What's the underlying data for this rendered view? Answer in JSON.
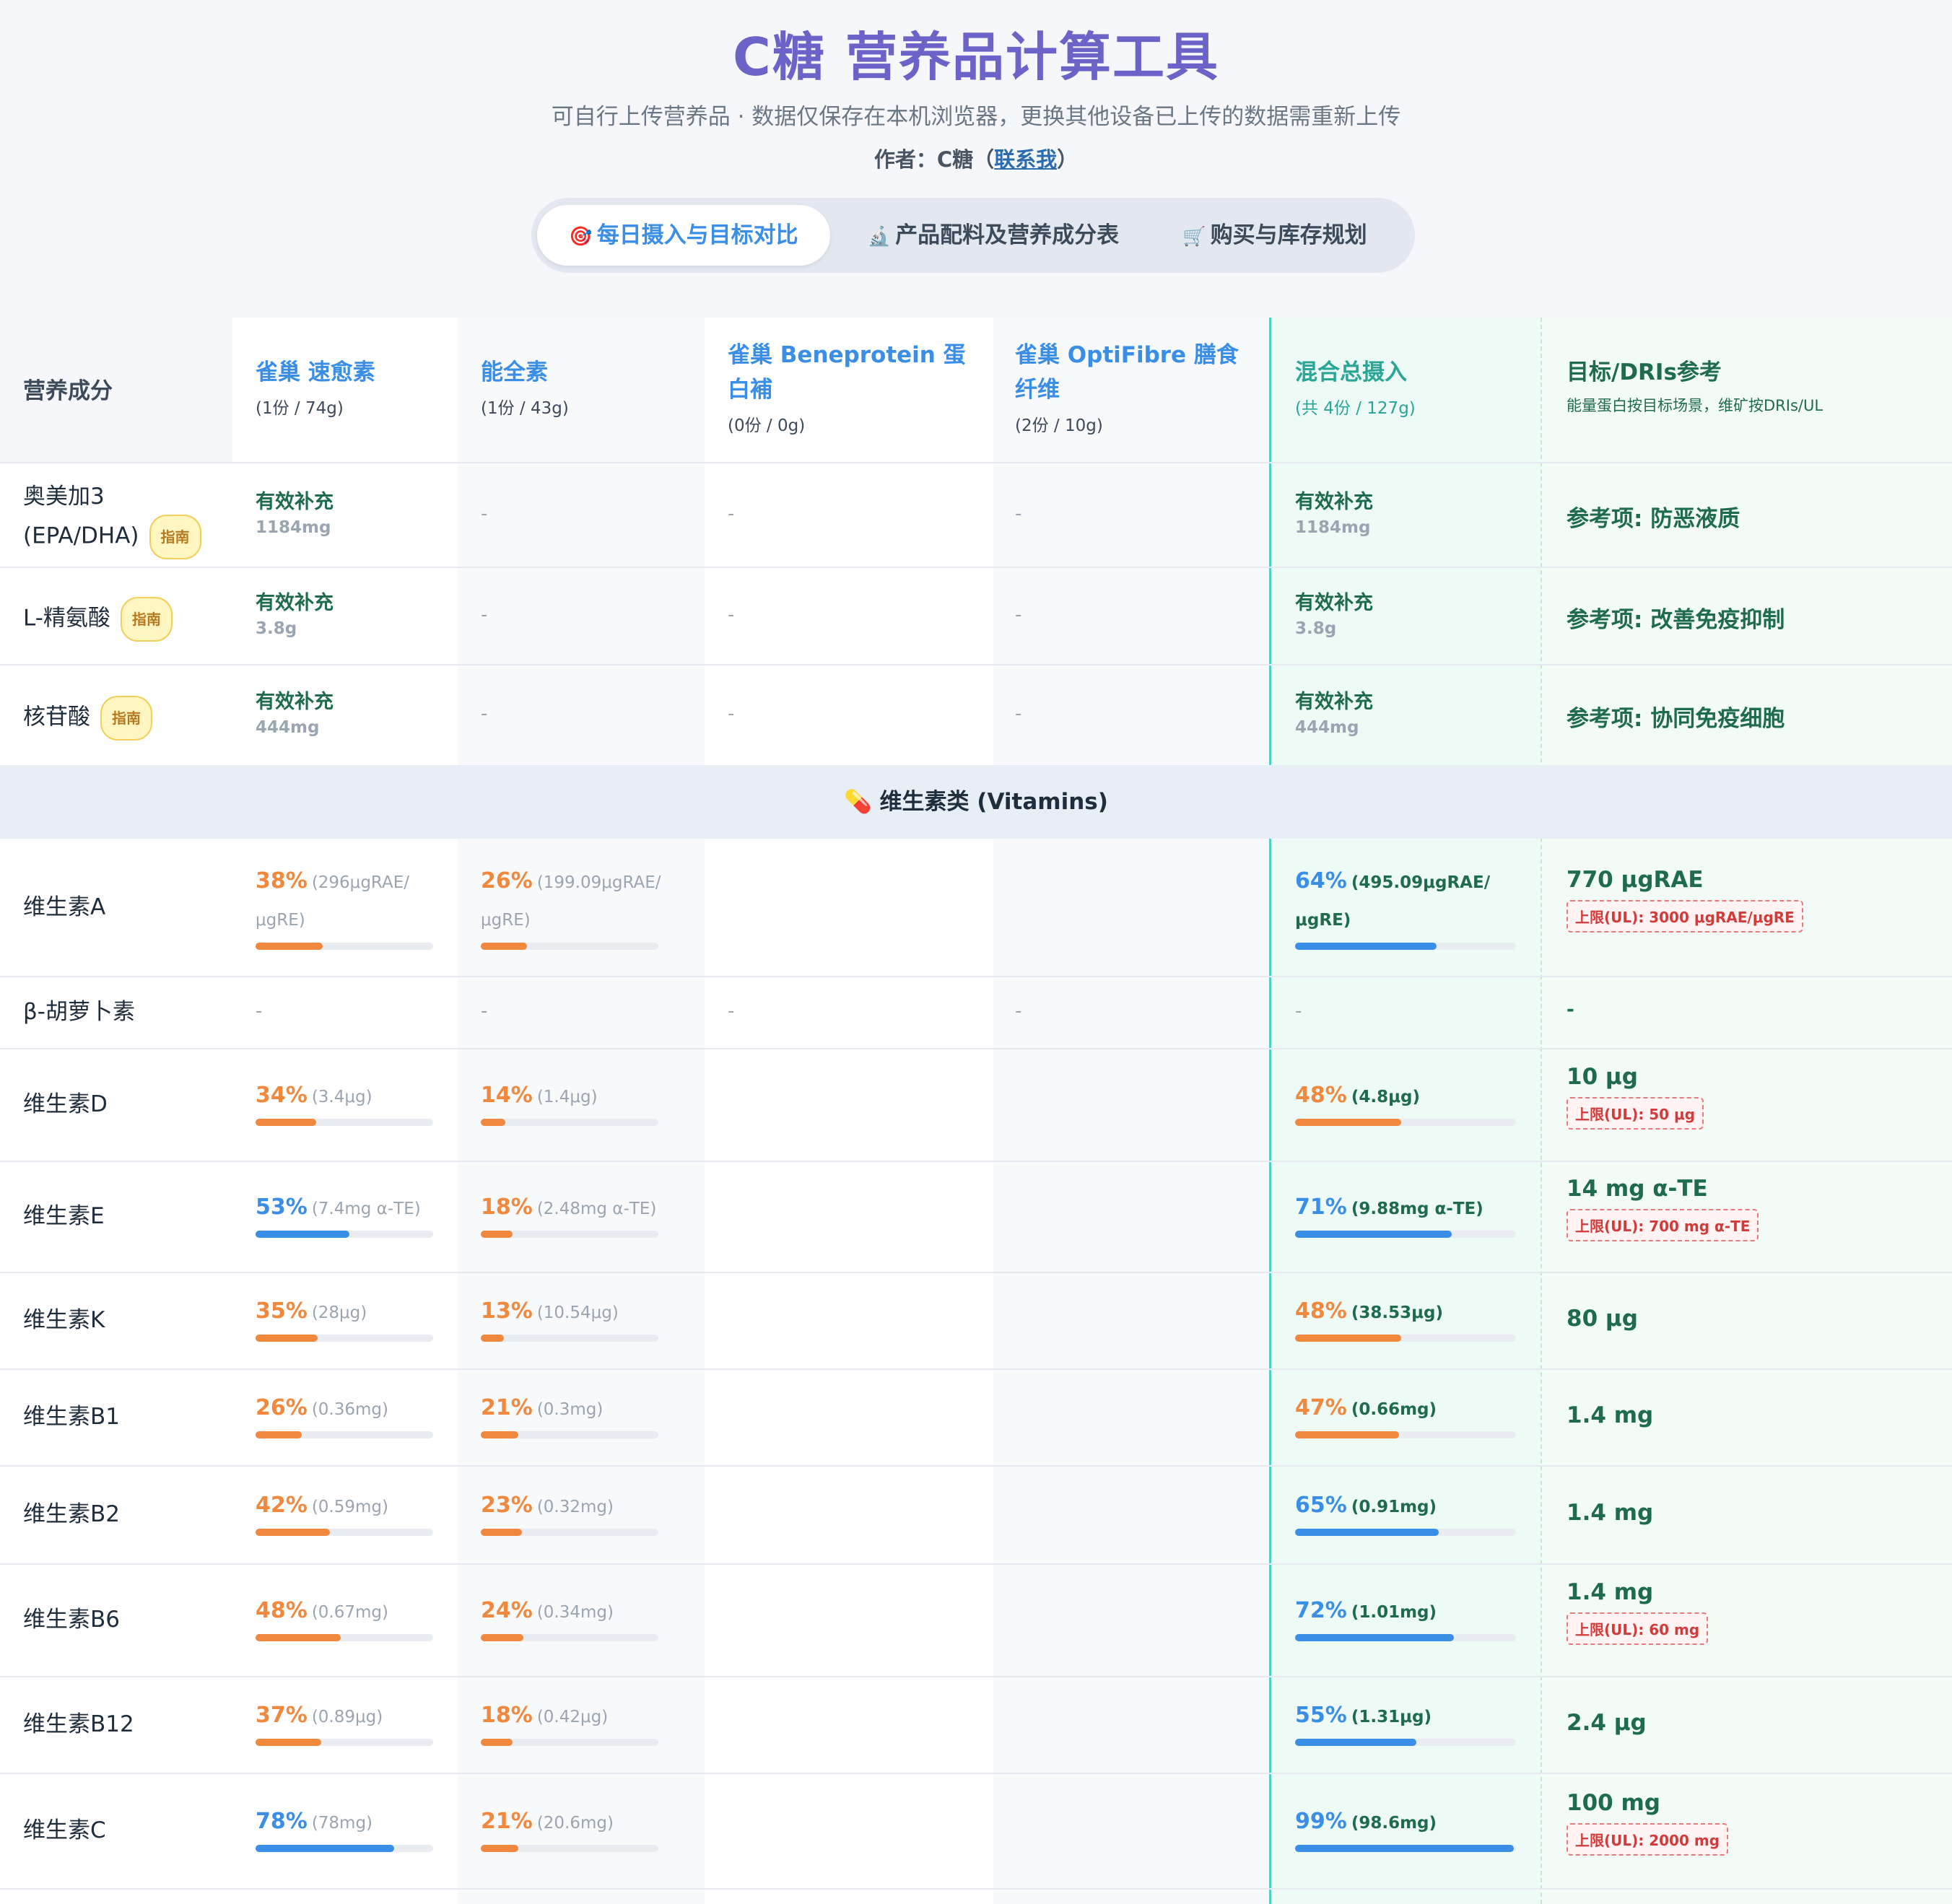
{
  "header": {
    "title": "C糖 营养品计算工具",
    "subtitle": "可自行上传营养品 · 数据仅保存在本机浏览器，更换其他设备已上传的数据需重新上传",
    "author_prefix": "作者：C糖（",
    "author_link": "联系我",
    "author_suffix": "）"
  },
  "tabs": [
    {
      "icon": "🎯",
      "label": "每日摄入与目标对比",
      "active": true
    },
    {
      "icon": "🔬",
      "label": "产品配料及营养成分表",
      "active": false
    },
    {
      "icon": "🛒",
      "label": "购买与库存规划",
      "active": false
    }
  ],
  "table": {
    "first_header": "营养成分",
    "columns": [
      {
        "name": "雀巢 速愈素",
        "sub": "(1份 / 74g)"
      },
      {
        "name": "能全素",
        "sub": "(1份 / 43g)"
      },
      {
        "name": "雀巢 Beneprotein 蛋白補",
        "sub": "(0份 / 0g)"
      },
      {
        "name": "雀巢 OptiFibre 膳食纤维",
        "sub": "(2份 / 10g)"
      },
      {
        "name": "混合总摄入",
        "sub": "(共 4份 / 127g)"
      },
      {
        "name": "目标/DRIs参考",
        "sub": "能量蛋白按目标场景，维矿按DRIs/UL"
      }
    ],
    "guide_label": "指南",
    "dash": "-",
    "special_rows": [
      {
        "name": "奥美加3 (EPA/DHA)",
        "status": "有效补充",
        "amount": "1184mg",
        "total_status": "有效补充",
        "total_amount": "1184mg",
        "ref": "参考项: 防恶液质"
      },
      {
        "name": "L-精氨酸",
        "status": "有效补充",
        "amount": "3.8g",
        "total_status": "有效补充",
        "total_amount": "3.8g",
        "ref": "参考项: 改善免疫抑制"
      },
      {
        "name": "核苷酸",
        "status": "有效补充",
        "amount": "444mg",
        "total_status": "有效补充",
        "total_amount": "444mg",
        "ref": "参考项: 协同免疫细胞"
      }
    ],
    "section_icon": "💊",
    "section_title": "维生素类 (Vitamins)",
    "vitamins": [
      {
        "name": "维生素A",
        "c1": {
          "pct": "38%",
          "val": "(296μgRAE/μgRE)",
          "fill": 38
        },
        "c2": {
          "pct": "26%",
          "val": "(199.09μgRAE/μgRE)",
          "fill": 26
        },
        "total": {
          "pct": "64%",
          "val": "(495.09μgRAE/μgRE)",
          "fill": 64
        },
        "target": "770 μgRAE",
        "ul": "上限(UL): 3000 μgRAE/μgRE"
      },
      {
        "name": "β-胡萝卜素",
        "empty": true,
        "target_dash": "-"
      },
      {
        "name": "维生素D",
        "c1": {
          "pct": "34%",
          "val": "(3.4μg)",
          "fill": 34
        },
        "c2": {
          "pct": "14%",
          "val": "(1.4μg)",
          "fill": 14
        },
        "total": {
          "pct": "48%",
          "val": "(4.8μg)",
          "fill": 48
        },
        "target": "10 μg",
        "ul": "上限(UL): 50 μg"
      },
      {
        "name": "维生素E",
        "c1": {
          "pct": "53%",
          "val": "(7.4mg α-TE)",
          "fill": 53
        },
        "c2": {
          "pct": "18%",
          "val": "(2.48mg α-TE)",
          "fill": 18
        },
        "total": {
          "pct": "71%",
          "val": "(9.88mg α-TE)",
          "fill": 71
        },
        "target": "14 mg α-TE",
        "ul": "上限(UL): 700 mg α-TE"
      },
      {
        "name": "维生素K",
        "c1": {
          "pct": "35%",
          "val": "(28μg)",
          "fill": 35
        },
        "c2": {
          "pct": "13%",
          "val": "(10.54μg)",
          "fill": 13
        },
        "total": {
          "pct": "48%",
          "val": "(38.53μg)",
          "fill": 48
        },
        "target": "80 μg"
      },
      {
        "name": "维生素B1",
        "c1": {
          "pct": "26%",
          "val": "(0.36mg)",
          "fill": 26
        },
        "c2": {
          "pct": "21%",
          "val": "(0.3mg)",
          "fill": 21
        },
        "total": {
          "pct": "47%",
          "val": "(0.66mg)",
          "fill": 47
        },
        "target": "1.4 mg"
      },
      {
        "name": "维生素B2",
        "c1": {
          "pct": "42%",
          "val": "(0.59mg)",
          "fill": 42
        },
        "c2": {
          "pct": "23%",
          "val": "(0.32mg)",
          "fill": 23
        },
        "total": {
          "pct": "65%",
          "val": "(0.91mg)",
          "fill": 65
        },
        "target": "1.4 mg"
      },
      {
        "name": "维生素B6",
        "c1": {
          "pct": "48%",
          "val": "(0.67mg)",
          "fill": 48
        },
        "c2": {
          "pct": "24%",
          "val": "(0.34mg)",
          "fill": 24
        },
        "total": {
          "pct": "72%",
          "val": "(1.01mg)",
          "fill": 72
        },
        "target": "1.4 mg",
        "ul": "上限(UL): 60 mg"
      },
      {
        "name": "维生素B12",
        "c1": {
          "pct": "37%",
          "val": "(0.89μg)",
          "fill": 37
        },
        "c2": {
          "pct": "18%",
          "val": "(0.42μg)",
          "fill": 18
        },
        "total": {
          "pct": "55%",
          "val": "(1.31μg)",
          "fill": 55
        },
        "target": "2.4 μg"
      },
      {
        "name": "维生素C",
        "c1": {
          "pct": "78%",
          "val": "(78mg)",
          "fill": 78
        },
        "c2": {
          "pct": "21%",
          "val": "(20.6mg)",
          "fill": 21
        },
        "total": {
          "pct": "99%",
          "val": "(98.6mg)",
          "fill": 99
        },
        "target": "100 mg",
        "ul": "上限(UL): 2000 mg"
      }
    ]
  },
  "colors": {
    "accent": "#3a8ee6",
    "orange": "#f0883e",
    "green": "#1f6b4d",
    "title": "#6c63c9"
  }
}
